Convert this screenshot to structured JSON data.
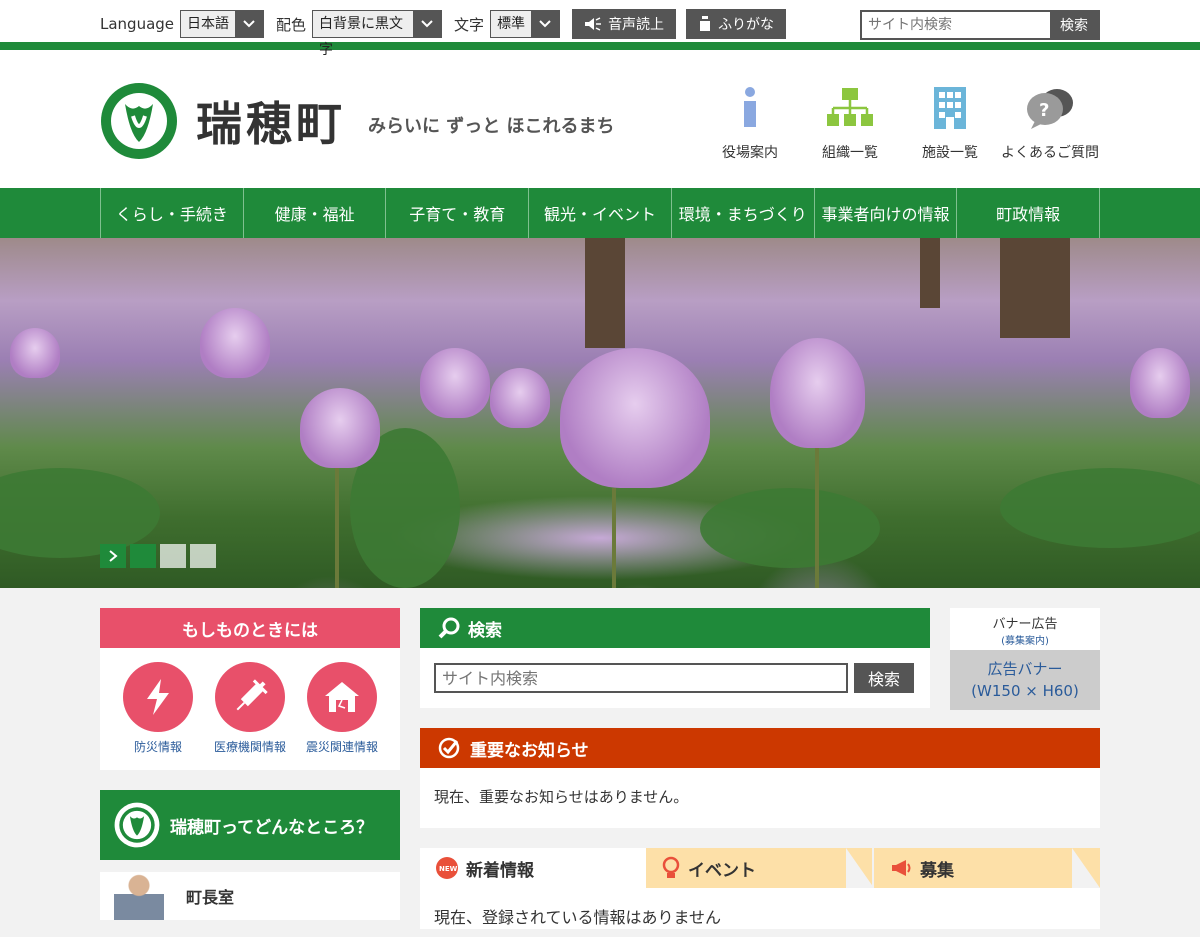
{
  "topbar": {
    "language_label": "Language",
    "language_value": "日本語",
    "color_label": "配色",
    "color_value": "白背景に黒文字",
    "text_label": "文字",
    "text_value": "標準",
    "read_aloud": "音声読上",
    "furigana": "ふりがな",
    "search_placeholder": "サイト内検索",
    "search_button": "検索"
  },
  "header": {
    "town_name": "瑞穂町",
    "tagline": "みらいに ずっと ほこれるまち",
    "quick_links": [
      {
        "label": "役場案内",
        "icon": "info-icon"
      },
      {
        "label": "組織一覧",
        "icon": "org-chart-icon"
      },
      {
        "label": "施設一覧",
        "icon": "building-icon"
      },
      {
        "label": "よくあるご質問",
        "icon": "faq-icon"
      }
    ]
  },
  "nav": {
    "items": [
      "くらし・手続き",
      "健康・福祉",
      "子育て・教育",
      "観光・イベント",
      "環境・まちづくり",
      "事業者向けの情報",
      "町政情報"
    ]
  },
  "emergency": {
    "title": "もしものときには",
    "items": [
      {
        "label": "防災情報",
        "icon": "lightning-icon"
      },
      {
        "label": "医療機関情報",
        "icon": "syringe-icon"
      },
      {
        "label": "震災関連情報",
        "icon": "house-icon"
      }
    ]
  },
  "search": {
    "title": "検索",
    "placeholder": "サイト内検索",
    "button": "検索"
  },
  "ad": {
    "label": "バナー広告",
    "sub": "(募集案内)",
    "banner_line1": "広告バナー",
    "banner_line2": "(W150 × H60)"
  },
  "about": {
    "title": "瑞穂町ってどんなところ？"
  },
  "mayor": {
    "label": "町長室"
  },
  "notice": {
    "title": "重要なお知らせ",
    "body": "現在、重要なお知らせはありません。"
  },
  "tabs": {
    "items": [
      {
        "label": "新着情報",
        "icon": "new-badge-icon",
        "active": true
      },
      {
        "label": "イベント",
        "icon": "lightbulb-icon",
        "active": false
      },
      {
        "label": "募集",
        "icon": "megaphone-icon",
        "active": false
      }
    ],
    "content": "現在、登録されている情報はありません"
  },
  "colors": {
    "brand_green": "#1f8a3a",
    "emergency_red": "#e8506a",
    "notice_orange": "#cc3800",
    "tab_inactive": "#fde0a8"
  }
}
